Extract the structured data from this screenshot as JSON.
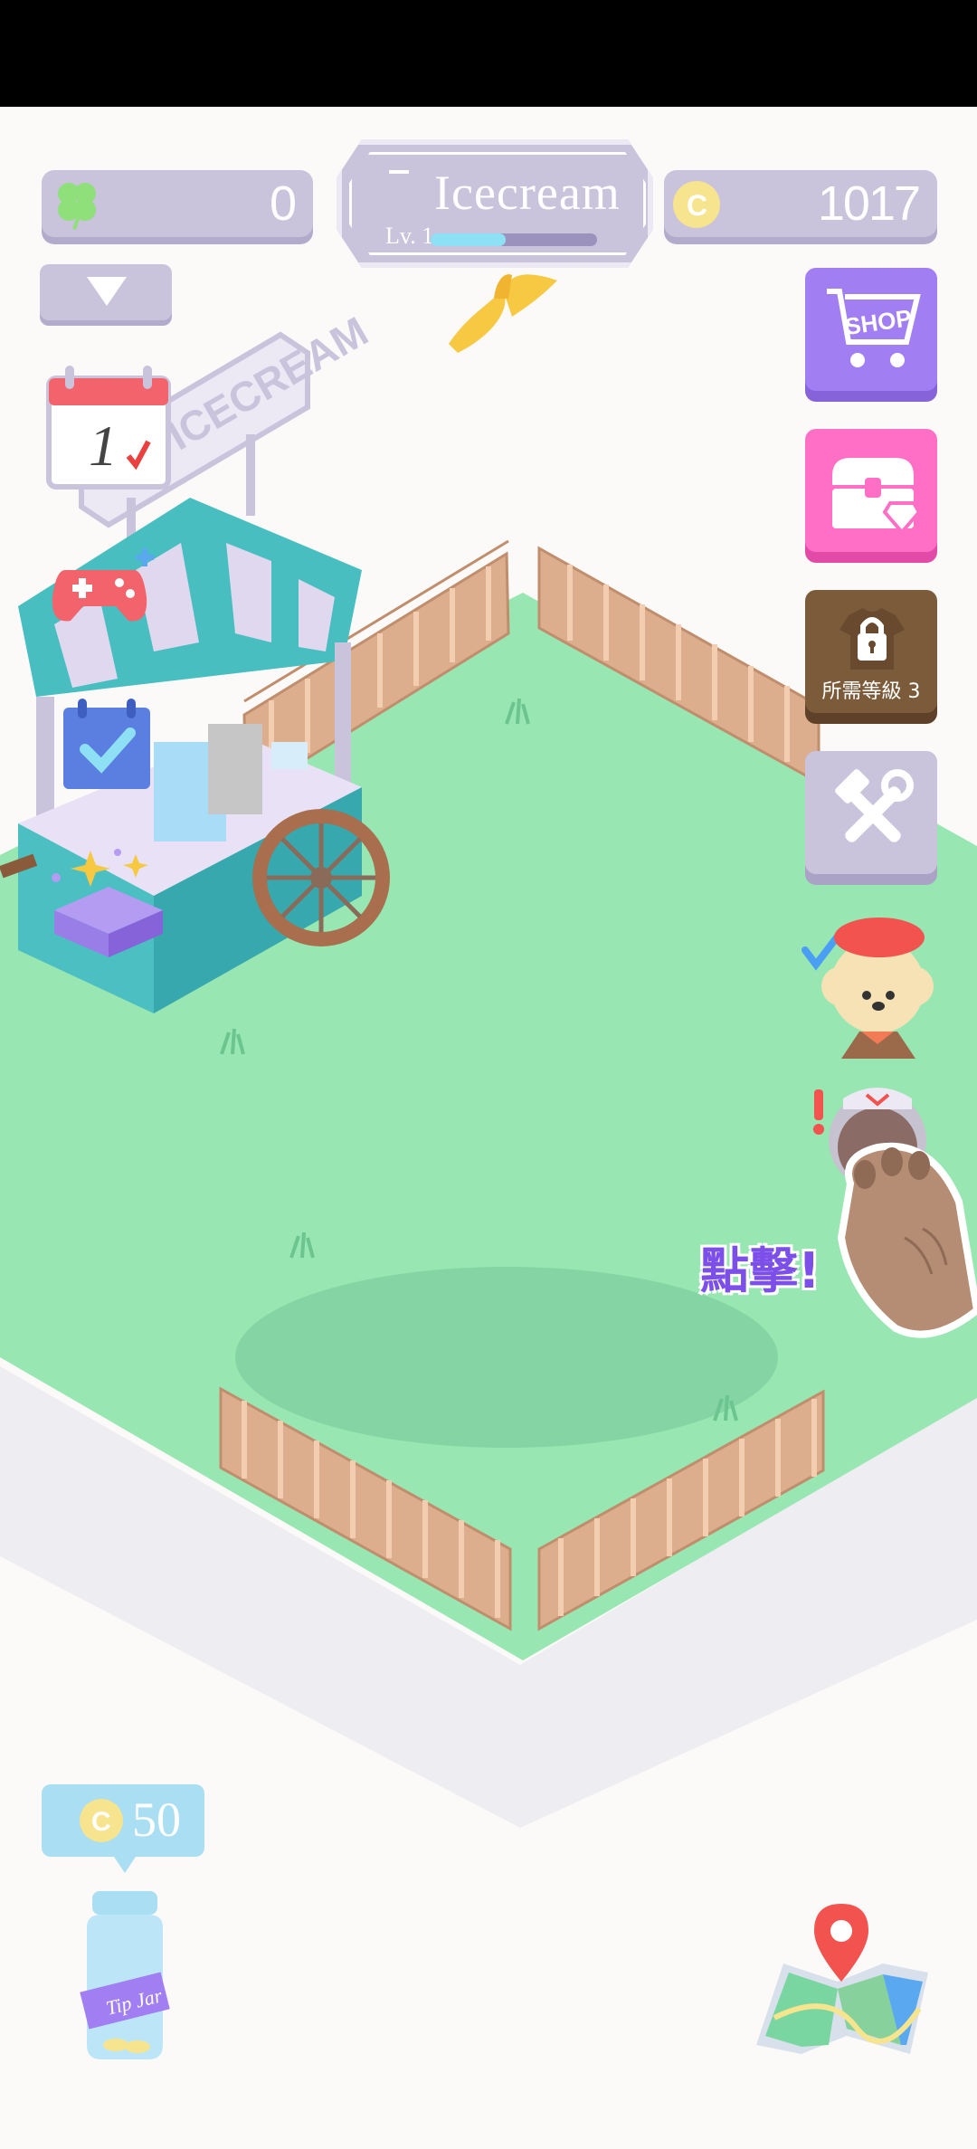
{
  "hud": {
    "clover_count": "0",
    "coin_count": "1017",
    "shop_title": "Icecream",
    "level_label": "Lv. 1",
    "level_progress": 0.45
  },
  "stand": {
    "sign_text": "ICECREAM",
    "calendar_day": "1"
  },
  "sidebar": {
    "shop_label": "SHOP",
    "locked_label": "所需等級 3"
  },
  "hint": {
    "click_label": "點擊!"
  },
  "tip_jar": {
    "amount": "50",
    "jar_label": "Tip Jar"
  },
  "colors": {
    "grass": "#98e6b2",
    "fence": "#dcae8e",
    "panel": "#c9c3dc",
    "accent_purple": "#a17ef2",
    "accent_pink": "#ff6fc6"
  },
  "icons": [
    "clover-icon",
    "coin-icon",
    "banana-peel-icon",
    "dropdown-arrow-icon",
    "calendar-icon",
    "gamepad-icon",
    "checklist-icon",
    "mystery-box-icon",
    "shop-cart-icon",
    "treasure-chest-icon",
    "locked-shirt-icon",
    "tools-icon",
    "poodle-customer-icon",
    "cat-customer-icon",
    "paw-pointer-icon",
    "tip-jar-icon",
    "map-icon"
  ]
}
